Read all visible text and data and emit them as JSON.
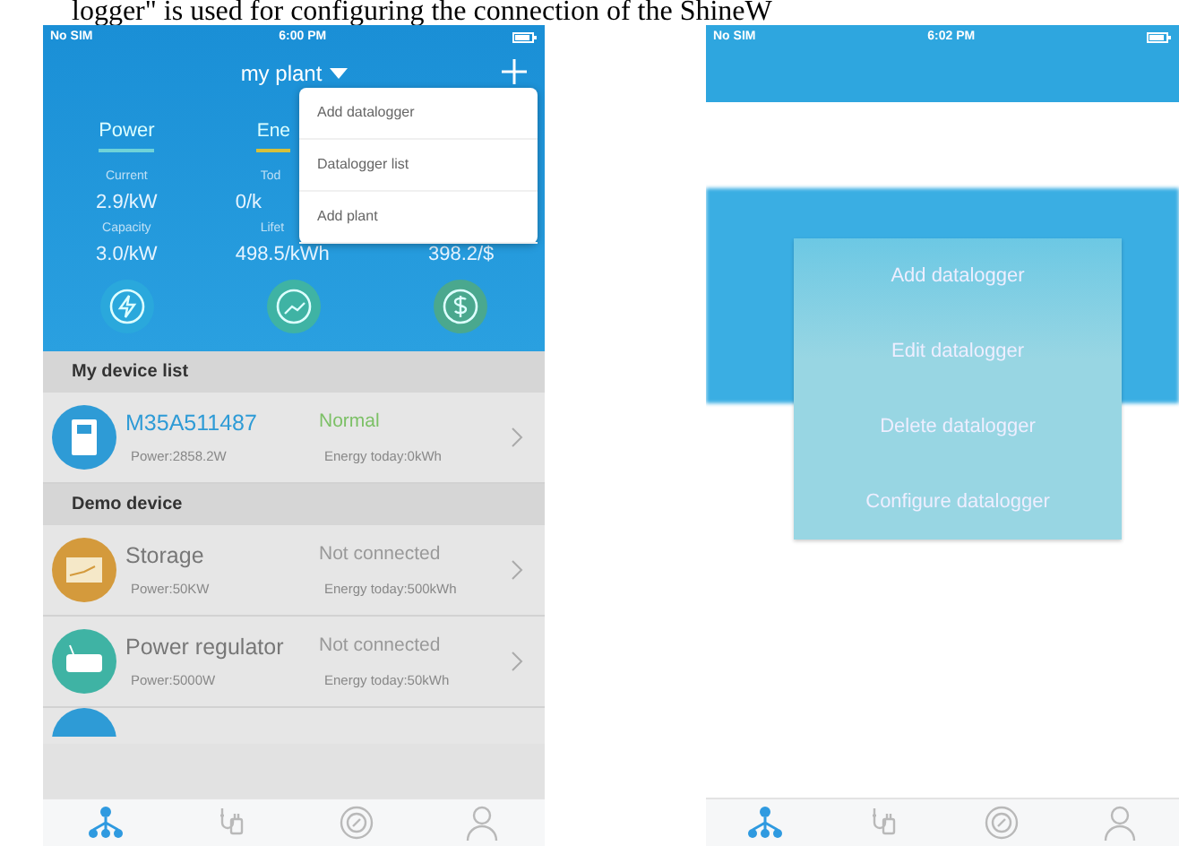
{
  "caption": "logger\" is used for configuring the connection of the ShineW",
  "left_phone": {
    "status_bar": {
      "carrier": "No SIM",
      "time": "6:00 PM"
    },
    "title": "my plant",
    "tabs": [
      {
        "label": "Power",
        "selected": true
      },
      {
        "label": "Ene",
        "selected": false
      }
    ],
    "stats": [
      {
        "label": "Current",
        "value": "2.9/kW"
      },
      {
        "label": "Tod",
        "value": "0/k"
      },
      {
        "label": "Capacity",
        "value": "3.0/kW"
      },
      {
        "label": "Lifet",
        "value": "498.5/kWh"
      },
      {
        "value": "398.2/$"
      }
    ],
    "menu": [
      "Add datalogger",
      "Datalogger list",
      "Add plant"
    ],
    "sections": [
      {
        "title": "My device list",
        "items": [
          {
            "kind": "inverter",
            "color": "#2e9bd6",
            "name": "M35A511487",
            "status": "Normal",
            "online": true,
            "power": "Power:2858.2W",
            "energy": "Energy today:0kWh"
          }
        ]
      },
      {
        "title": "Demo device",
        "items": [
          {
            "kind": "storage",
            "color": "#d49a3c",
            "name": "Storage",
            "status": "Not connected",
            "online": false,
            "power": "Power:50KW",
            "energy": "Energy today:500kWh"
          },
          {
            "kind": "regulator",
            "color": "#3fb3a4",
            "name": "Power regulator",
            "status": "Not connected",
            "online": false,
            "power": "Power:5000W",
            "energy": "Energy today:50kWh"
          }
        ]
      }
    ],
    "tab_bar": [
      {
        "kind": "device",
        "selected": true
      },
      {
        "kind": "energy",
        "selected": false
      },
      {
        "kind": "service",
        "selected": false
      },
      {
        "kind": "me",
        "selected": false
      }
    ]
  },
  "right_phone": {
    "status_bar": {
      "carrier": "No SIM",
      "time": "6:02 PM"
    },
    "dialog": [
      "Add datalogger",
      "Edit datalogger",
      "Delete datalogger",
      "Configure datalogger"
    ],
    "tab_bar": [
      {
        "kind": "device",
        "selected": true
      },
      {
        "kind": "energy",
        "selected": false
      },
      {
        "kind": "service",
        "selected": false
      },
      {
        "kind": "me",
        "selected": false
      }
    ]
  }
}
